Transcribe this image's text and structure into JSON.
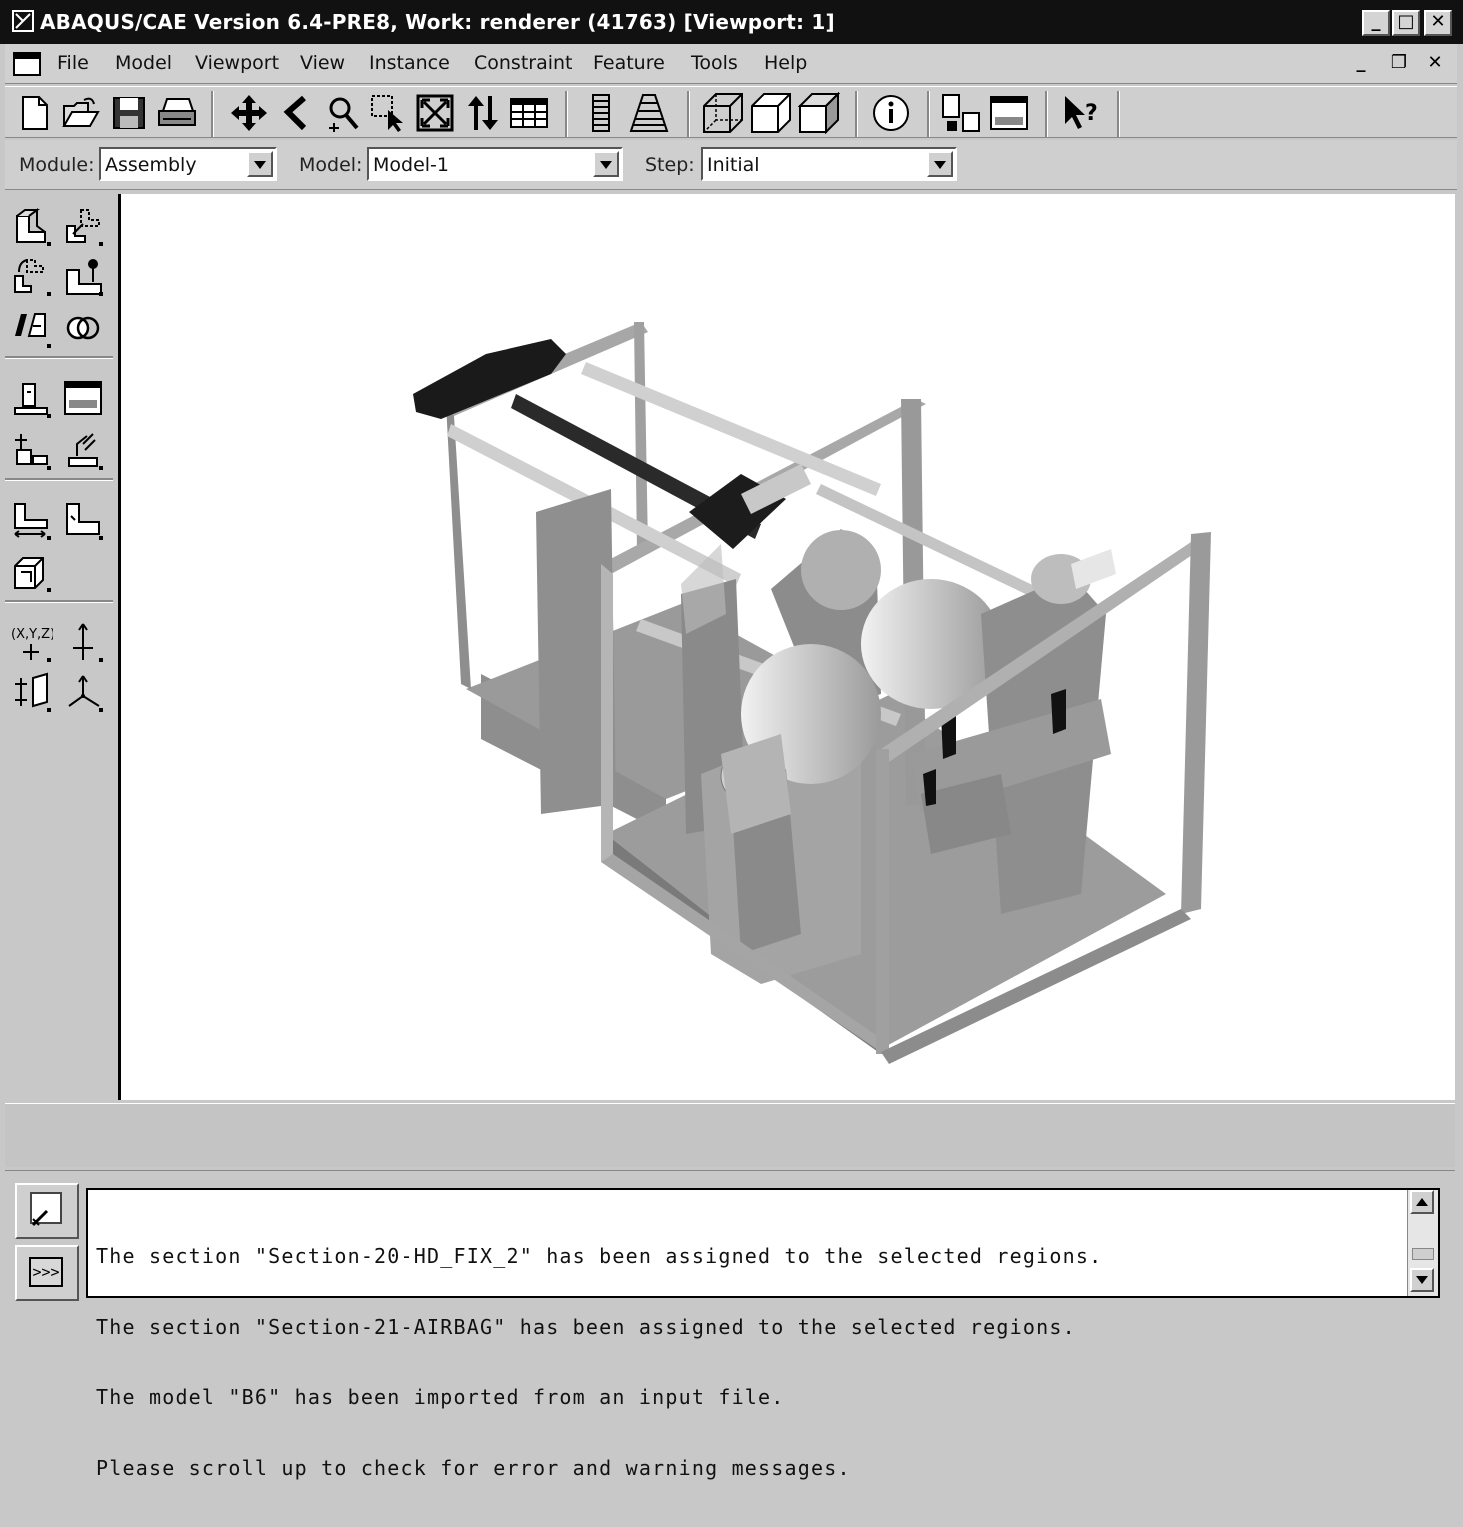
{
  "window": {
    "title": "ABAQUS/CAE Version 6.4-PRE8, Work: renderer (41763) [Viewport: 1]",
    "buttons": [
      "minimize",
      "maximize",
      "close"
    ]
  },
  "menubar": {
    "items": [
      {
        "label": "File"
      },
      {
        "label": "Model"
      },
      {
        "label": "Viewport"
      },
      {
        "label": "View"
      },
      {
        "label": "Instance"
      },
      {
        "label": "Constraint"
      },
      {
        "label": "Feature"
      },
      {
        "label": "Tools"
      },
      {
        "label": "Help"
      }
    ]
  },
  "toolbar": {
    "icons": [
      "new-file-icon",
      "open-file-icon",
      "save-icon",
      "print-icon",
      "pan-icon",
      "rotate-icon",
      "magnify-icon",
      "box-zoom-icon",
      "auto-fit-icon",
      "cycle-icon",
      "table-icon",
      "perspective-icon",
      "parallel-icon",
      "render-wireframe-icon",
      "render-hidden-icon",
      "render-shaded-icon",
      "query-info-icon",
      "viewport-layout-icon",
      "viewport-annotation-icon",
      "context-help-icon"
    ]
  },
  "context": {
    "module_label": "Module:",
    "module_value": "Assembly",
    "model_label": "Model:",
    "model_value": "Model-1",
    "step_label": "Step:",
    "step_value": "Initial"
  },
  "toolbox": {
    "icons": [
      "instance-part-icon",
      "linear-pattern-icon",
      "radial-pattern-icon",
      "translate-instance-icon",
      "rotate-instance-icon",
      "merge-instances-icon",
      "parallel-face-icon",
      "edge-to-edge-icon",
      "coaxial-icon",
      "coincident-point-icon",
      "parallel-csys-icon",
      "face-to-face-icon",
      "convert-constraints-icon",
      "datum-point-icon",
      "datum-axis-icon",
      "datum-plane-icon",
      "datum-csys-icon"
    ]
  },
  "messages": {
    "lines": [
      "The section \"Section-20-HD_FIX_2\" has been assigned to the selected regions.",
      "The section \"Section-21-AIRBAG\" has been assigned to the selected regions.",
      "The model \"B6\" has been imported from an input file.",
      "Please scroll up to check for error and warning messages."
    ],
    "tabs": [
      "message-area-tab-icon",
      "command-line-tab-icon"
    ],
    "command_tab_label": ">>>"
  },
  "colors": {
    "titlebar": "#111111",
    "chrome": "#c8c8c8",
    "viewport_bg": "#ffffff"
  }
}
